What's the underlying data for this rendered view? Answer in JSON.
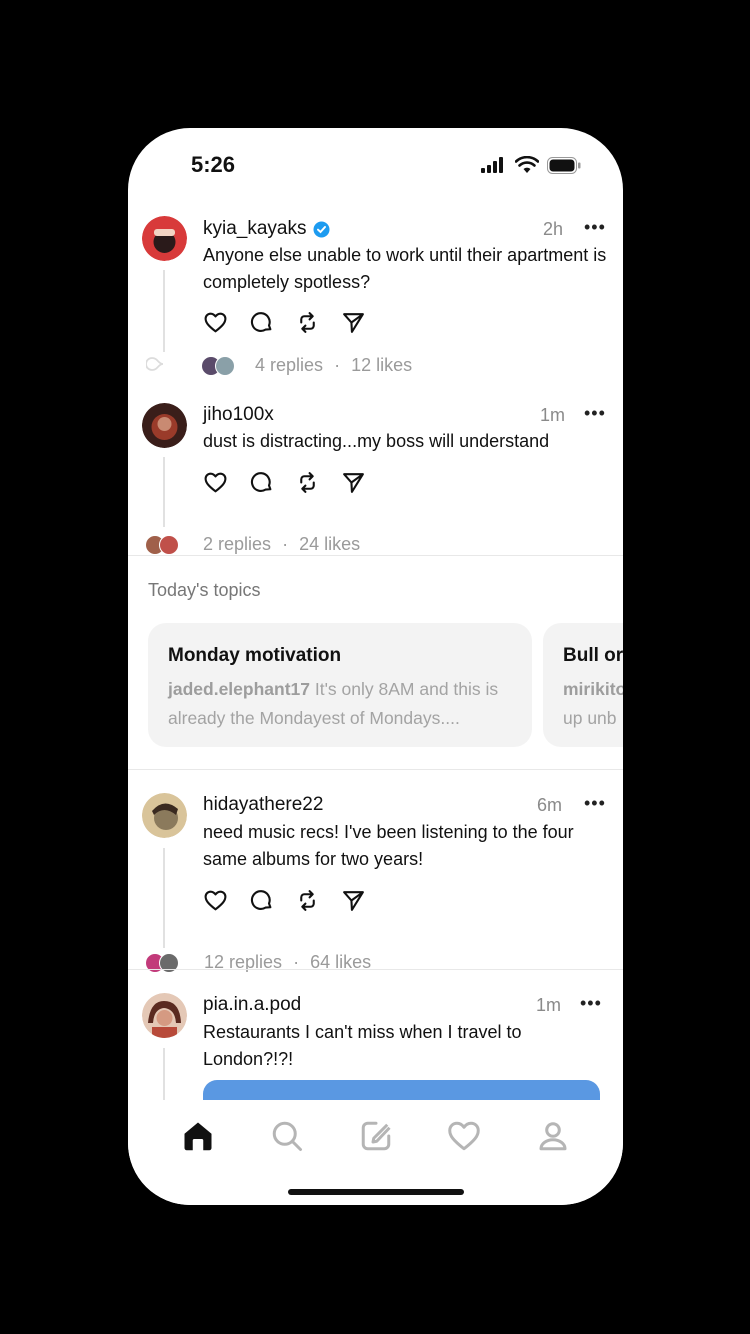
{
  "status": {
    "time": "5:26"
  },
  "posts": [
    {
      "username": "kyia_kayaks",
      "verified": true,
      "time": "2h",
      "more": "•••",
      "text": "Anyone else unable to work until their apartment is completely spotless?",
      "replies": "4 replies",
      "likes": "12 likes",
      "avatar_color": "#d83a3a"
    },
    {
      "username": "jiho100x",
      "verified": false,
      "time": "1m",
      "more": "•••",
      "text": "dust is distracting...my boss will understand",
      "replies": "2 replies",
      "likes": "24 likes",
      "avatar_color": "#7a2e24"
    },
    {
      "username": "hidayathere22",
      "verified": false,
      "time": "6m",
      "more": "•••",
      "text": "need music recs! I've been listening to the four same albums for two years!",
      "replies": "12 replies",
      "likes": "64 likes",
      "avatar_color": "#8b7a5c"
    },
    {
      "username": "pia.in.a.pod",
      "verified": false,
      "time": "1m",
      "more": "•••",
      "text": "Restaurants I can't miss when I travel to London?!?!",
      "avatar_color": "#b84a3a"
    }
  ],
  "separator": "·",
  "topics": {
    "heading": "Today's topics",
    "cards": [
      {
        "title": "Monday motivation",
        "author": "jaded.elephant17",
        "text": " It's only 8AM and this is already the Mondayest of Mondays...."
      },
      {
        "title": "Bull or",
        "author": "mirikito",
        "text": " up unb"
      }
    ]
  },
  "tabs": [
    {
      "name": "home-icon"
    },
    {
      "name": "search-icon"
    },
    {
      "name": "compose-icon"
    },
    {
      "name": "heart-icon"
    },
    {
      "name": "profile-icon"
    }
  ],
  "colors": {
    "accent": "#1d9bf0",
    "image_bar": "#5a98e2"
  }
}
